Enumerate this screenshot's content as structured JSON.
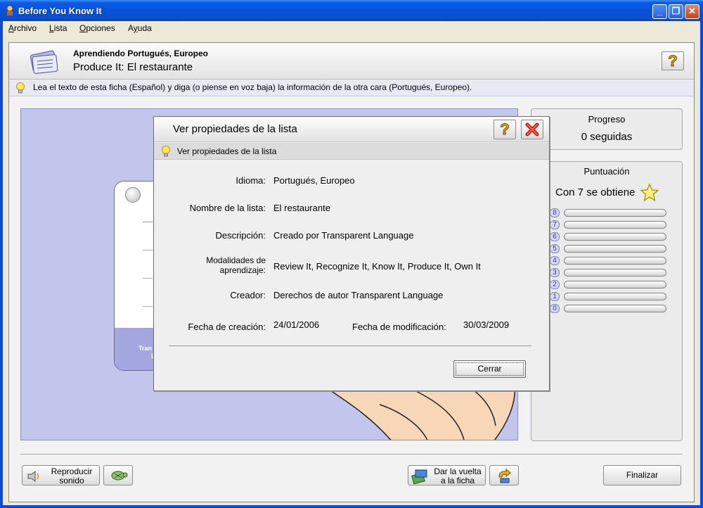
{
  "window": {
    "title": "Before You Know It",
    "controls": {
      "minimize": "_",
      "maximize": "❐",
      "close": "✕"
    }
  },
  "menubar": {
    "items": [
      {
        "label": "Archivo",
        "accel": "A",
        "rest": "rchivo"
      },
      {
        "label": "Lista",
        "accel": "L",
        "rest": "ista"
      },
      {
        "label": "Opciones",
        "accel": "O",
        "rest": "pciones"
      },
      {
        "label": "Ayuda",
        "accel": "y",
        "pre": "A",
        "rest": "uda"
      }
    ]
  },
  "header": {
    "course": "Aprendiendo Portugués, Europeo",
    "activity": "Produce It: El restaurante",
    "help_icon": "question-icon"
  },
  "hint": {
    "text": "Lea el texto de esta ficha (Español) y diga (o piense en voz baja) la información de la otra cara (Portugués, Europeo)."
  },
  "progress": {
    "title": "Progreso",
    "value": "0 seguidas"
  },
  "score": {
    "title": "Puntuación",
    "goal": "Con 7 se obtiene",
    "levels": [
      "8",
      "7",
      "6",
      "5",
      "4",
      "3",
      "2",
      "1",
      "0"
    ]
  },
  "buttons": {
    "play_sound": "Reproducir sonido",
    "play_sound_l1": "Reproducir",
    "play_sound_l2": "sonido",
    "flip_l1": "Dar la vuelta",
    "flip_l2": "a la ficha",
    "finish": "Finalizar"
  },
  "flashcard": {
    "partial_text_1": "Tran",
    "partial_text_2": "L"
  },
  "dialog": {
    "title": "Ver propiedades de la lista",
    "hint": "Ver propiedades de la lista",
    "properties": {
      "language_label": "Idioma:",
      "language_value": "Portugués, Europeo",
      "list_name_label": "Nombre de la lista:",
      "list_name_value": "El restaurante",
      "description_label": "Descripción:",
      "description_value": "Creado por Transparent Language",
      "modes_label_l1": "Modalidades de",
      "modes_label_l2": "aprendizaje:",
      "modes_value": "Review It, Recognize It, Know It, Produce It, Own It",
      "creator_label": "Creador:",
      "creator_value": "Derechos de autor Transparent Language",
      "created_label": "Fecha de creación:",
      "created_value": "24/01/2006",
      "modified_label": "Fecha de modificación:",
      "modified_value": "30/03/2009"
    },
    "close_button": "Cerrar"
  },
  "colors": {
    "titlebar": "#0652d6",
    "card_area": "#c3c6ec",
    "card_bottom": "#a4a7df"
  }
}
